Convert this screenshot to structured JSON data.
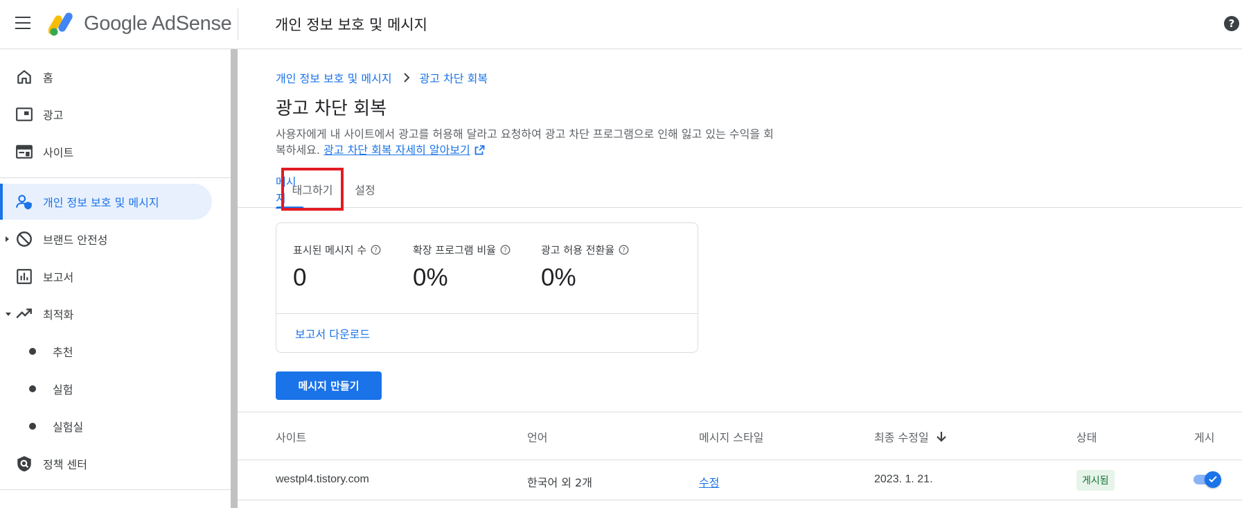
{
  "header": {
    "brand": "Google AdSense",
    "title": "개인 정보 보호 및 메시지"
  },
  "sidebar": {
    "items": [
      {
        "label": "홈",
        "icon": "home-icon"
      },
      {
        "label": "광고",
        "icon": "ads-icon"
      },
      {
        "label": "사이트",
        "icon": "sites-icon"
      },
      {
        "label": "개인 정보 보호 및 메시지",
        "icon": "privacy-messaging-icon",
        "active": true
      },
      {
        "label": "브랜드 안전성",
        "icon": "block-icon"
      },
      {
        "label": "보고서",
        "icon": "reports-icon"
      },
      {
        "label": "최적화",
        "icon": "trending-up-icon"
      },
      {
        "label": "추천"
      },
      {
        "label": "실험"
      },
      {
        "label": "실험실"
      },
      {
        "label": "정책 센터",
        "icon": "policy-center-icon"
      }
    ]
  },
  "breadcrumb": {
    "parent": "개인 정보 보호 및 메시지",
    "current": "광고 차단 회복"
  },
  "page": {
    "title": "광고 차단 회복",
    "description": "사용자에게 내 사이트에서 광고를 허용해 달라고 요청하여 광고 차단 프로그램으로 인해 잃고 있는 수익을 회복하세요.",
    "learn_more": "광고 차단 회복 자세히 알아보기"
  },
  "tabs": [
    {
      "label": "메시지",
      "active": true
    },
    {
      "label": "태그하기",
      "highlighted": true
    },
    {
      "label": "설정"
    }
  ],
  "stats": {
    "items": [
      {
        "label": "표시된 메시지 수",
        "value": "0"
      },
      {
        "label": "확장 프로그램 비율",
        "value": "0%"
      },
      {
        "label": "광고 허용 전환율",
        "value": "0%"
      }
    ],
    "download_link": "보고서 다운로드"
  },
  "create_button": "메시지 만들기",
  "table": {
    "headers": [
      "사이트",
      "언어",
      "메시지 스타일",
      "최종 수정일",
      "상태",
      "게시"
    ],
    "rows": [
      {
        "site": "westpl4.tistory.com",
        "language": "한국어 외 2개",
        "style": "수정",
        "modified": "2023. 1. 21.",
        "status": "게시됨",
        "published": true
      }
    ]
  },
  "colors": {
    "accent": "#1a73e8",
    "active_bg": "#e8f0fe",
    "highlight_border": "#e21b23",
    "status_green": "#137333"
  }
}
